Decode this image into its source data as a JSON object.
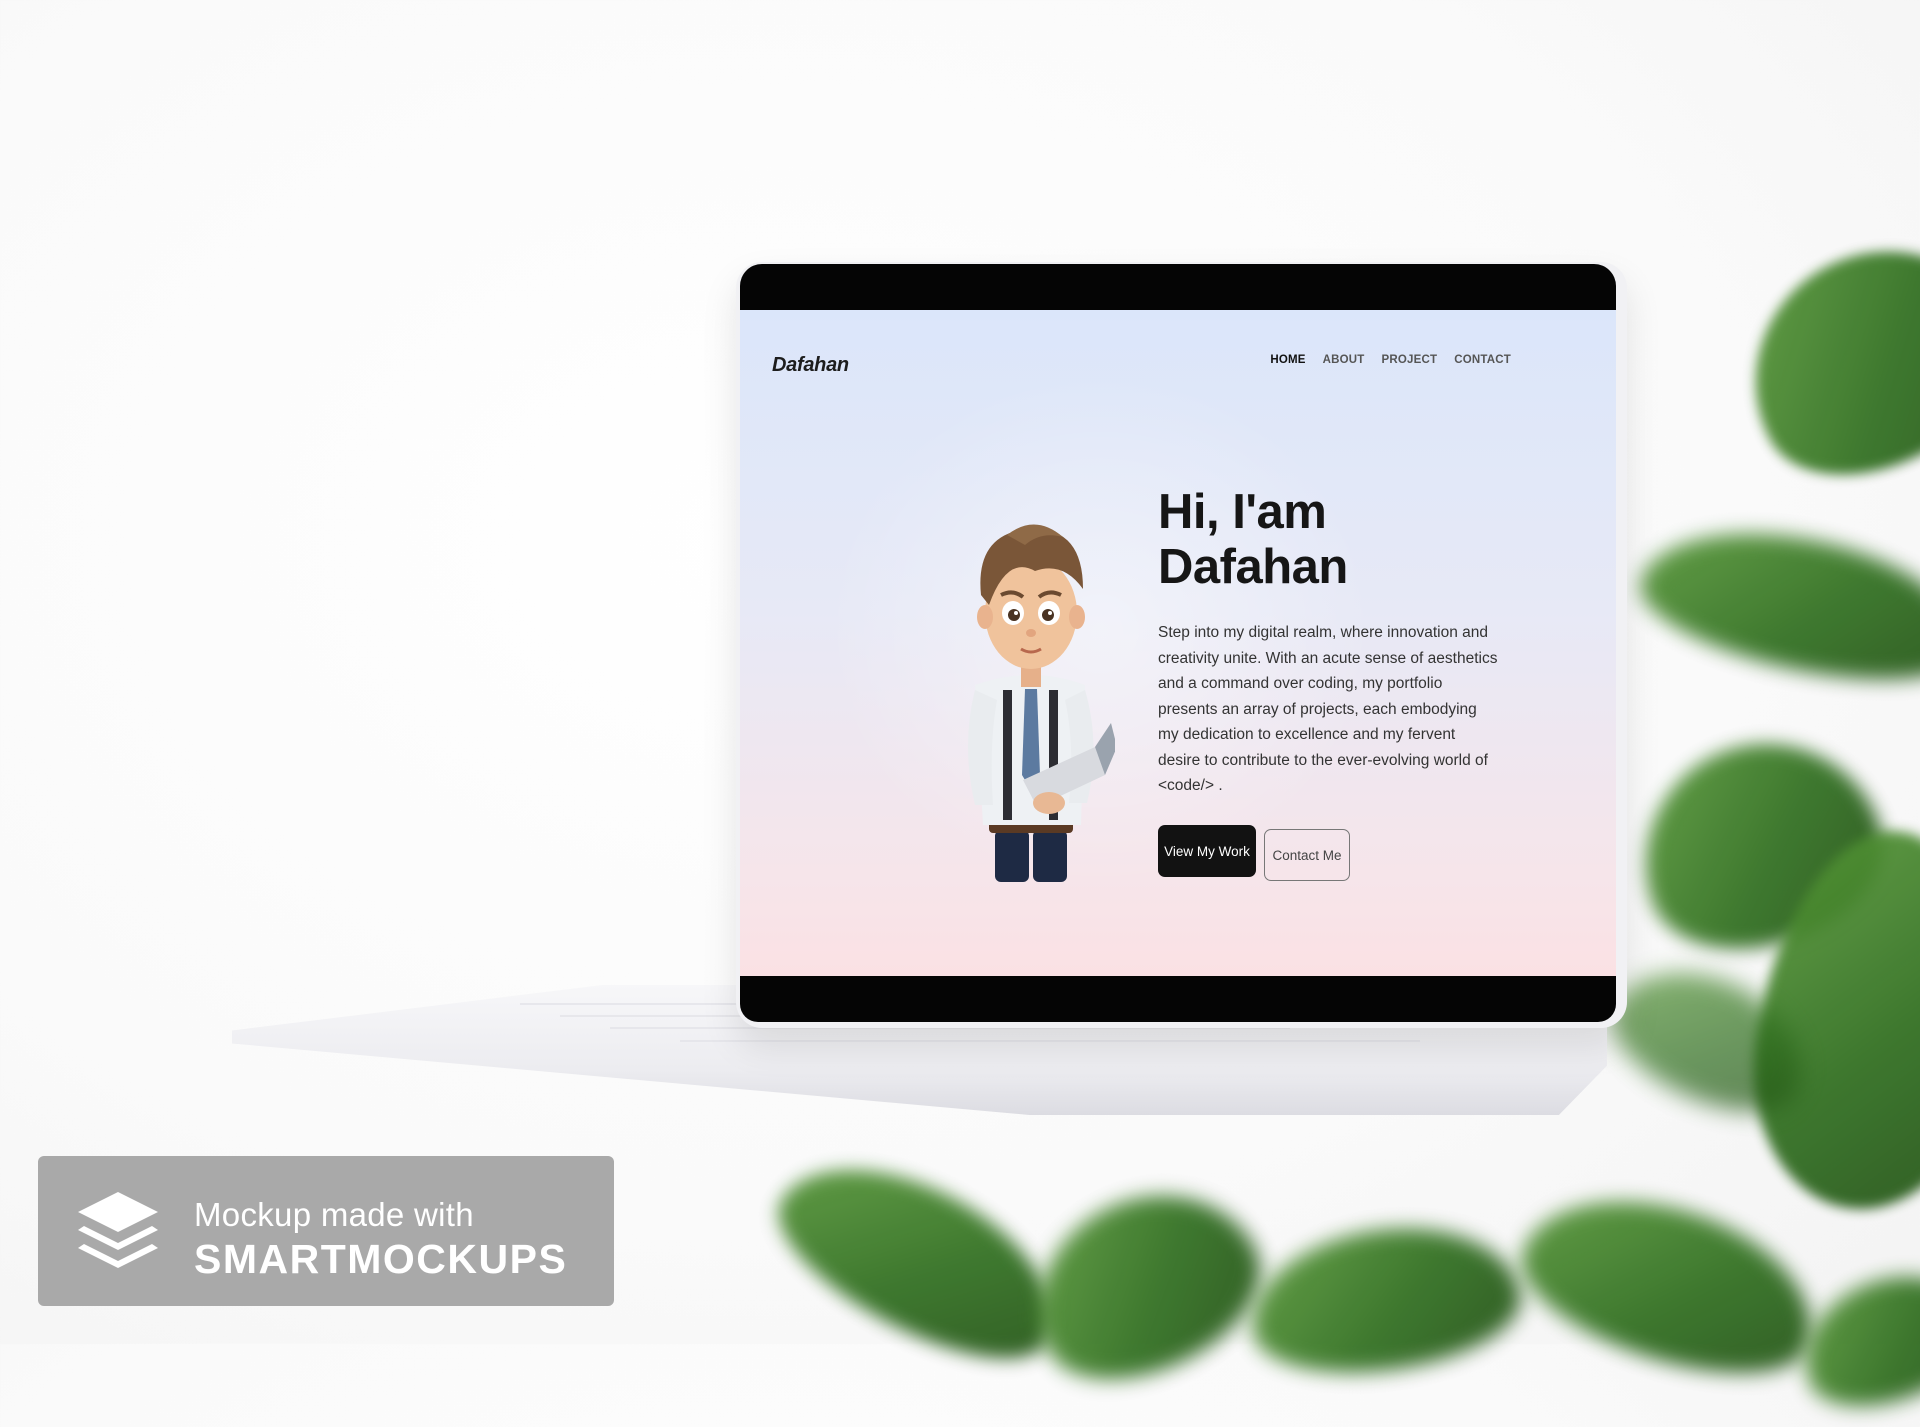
{
  "site": {
    "logo": "Dafahan",
    "nav": [
      {
        "label": "HOME",
        "active": true
      },
      {
        "label": "ABOUT",
        "active": false
      },
      {
        "label": "PROJECT",
        "active": false
      },
      {
        "label": "CONTACT",
        "active": false
      }
    ],
    "hero": {
      "heading_line1": "Hi, I'am",
      "heading_line2": "Dafahan",
      "description": "Step into my digital realm, where innovation and creativity unite. With an acute sense of aesthetics and a command over coding, my portfolio presents an array of projects, each embodying my dedication to excellence and my fervent desire to contribute to the ever-evolving world of <code/> .",
      "primary_button": "View My Work",
      "secondary_button": "Contact Me"
    }
  },
  "badge": {
    "line1": "Mockup made with",
    "line2": "SMARTMOCKUPS",
    "icon": "stacked-layers-icon"
  },
  "colors": {
    "accent": "#121212",
    "screen_top": "#dbe6fa",
    "screen_bottom": "#fbe1e4",
    "badge_bg": "#a9a9a9"
  }
}
